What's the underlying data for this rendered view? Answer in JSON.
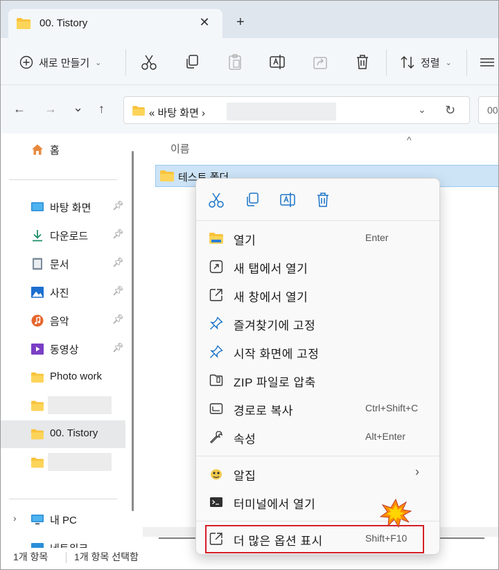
{
  "tab": {
    "title": "00. Tistory",
    "close": "✕",
    "new": "+"
  },
  "toolbar": {
    "new_label": "새로 만들기",
    "sort_label": "정렬"
  },
  "nav": {
    "back": "←",
    "forward": "→",
    "recent": "⌄",
    "up": "↑"
  },
  "address": {
    "path": "« 바탕 화면 ›",
    "dropdown": "⌄",
    "refresh": "↻",
    "search_placeholder": "00"
  },
  "sidebar": {
    "home": "홈",
    "items": [
      {
        "label": "바탕 화면",
        "pinned": true
      },
      {
        "label": "다운로드",
        "pinned": true
      },
      {
        "label": "문서",
        "pinned": true
      },
      {
        "label": "사진",
        "pinned": true
      },
      {
        "label": "음악",
        "pinned": true
      },
      {
        "label": "동영상",
        "pinned": true
      },
      {
        "label": "Photo work",
        "pinned": false
      },
      {
        "label": "",
        "pinned": false
      },
      {
        "label": "00. Tistory",
        "pinned": false
      },
      {
        "label": "",
        "pinned": false
      }
    ],
    "pc": "내 PC",
    "network": "네트워크"
  },
  "content": {
    "column_name": "이름",
    "sort_arrow": "^",
    "selected_item": "테스트 폴더"
  },
  "status": {
    "count": "1개 항목",
    "selection": "1개 항목 선택함"
  },
  "context_menu": {
    "items": [
      {
        "label": "열기",
        "shortcut": "Enter"
      },
      {
        "label": "새 탭에서 열기",
        "shortcut": ""
      },
      {
        "label": "새 창에서 열기",
        "shortcut": ""
      },
      {
        "label": "즐겨찾기에 고정",
        "shortcut": ""
      },
      {
        "label": "시작 화면에 고정",
        "shortcut": ""
      },
      {
        "label": "ZIP 파일로 압축",
        "shortcut": ""
      },
      {
        "label": "경로로 복사",
        "shortcut": "Ctrl+Shift+C"
      },
      {
        "label": "속성",
        "shortcut": "Alt+Enter"
      },
      {
        "label": "알집",
        "shortcut": "›"
      },
      {
        "label": "터미널에서 열기",
        "shortcut": ""
      },
      {
        "label": "더 많은 옵션 표시",
        "shortcut": "Shift+F10"
      }
    ]
  },
  "colors": {
    "highlight_box": "#d41f27",
    "selection": "#cde4f7",
    "folder": "#f8c33c",
    "burst": "#ff8c00"
  }
}
